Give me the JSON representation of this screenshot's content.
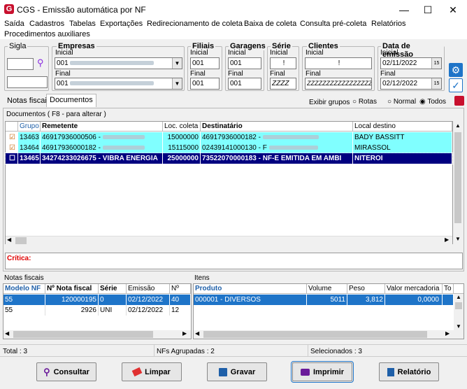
{
  "window": {
    "title": "CGS - Emissão automática por NF",
    "logo_letter": "G"
  },
  "menu": [
    "Saída",
    "Cadastros",
    "Tabelas",
    "Exportações",
    "Redirecionamento de coleta",
    "Baixa de coleta",
    "Consulta pré-coleta",
    "Relatórios",
    "Procedimentos auxiliares"
  ],
  "filters": {
    "sigla": {
      "label": "Sigla"
    },
    "empresas": {
      "label": "Empresas",
      "inicial_label": "Inicial",
      "inicial": "001",
      "final_label": "Final",
      "final": "001"
    },
    "filiais": {
      "label": "Filiais",
      "inicial_label": "Inicial",
      "inicial": "001",
      "final_label": "Final",
      "final": "001"
    },
    "garagens": {
      "label": "Garagens",
      "inicial_label": "Inicial",
      "inicial": "001",
      "final_label": "Final",
      "final": "001"
    },
    "serie": {
      "label": "Série",
      "inicial_label": "Inicial",
      "inicial": "!",
      "final_label": "Final",
      "final": "ZZZZ"
    },
    "clientes": {
      "label": "Clientes",
      "inicial_label": "Inicial",
      "inicial": "!",
      "final_label": "Final",
      "final": "ZZZZZZZZZZZZZZZZZZ"
    },
    "data": {
      "label": "Data de emissão",
      "inicial_label": "Inicial",
      "inicial": "02/11/2022",
      "final_label": "Final",
      "final": "02/12/2022"
    }
  },
  "tabs": [
    "Notas fiscais",
    "Documentos"
  ],
  "exibir": {
    "label": "Exibir grupos",
    "options": [
      "Rotas",
      "Normal",
      "Todos"
    ],
    "selected": "Todos"
  },
  "documentos": {
    "caption": "Documentos ( F8 - para alterar )",
    "columns": [
      "Grupo",
      "Remetente",
      "Loc. coleta",
      "Destinatário",
      "Local destino"
    ],
    "rows": [
      {
        "grupo": "13463",
        "remetente": "46917936000506 -",
        "loc": "15000000",
        "dest": "46917936000182 -",
        "local": "BADY BASSITT",
        "checked": true,
        "state": "cyan"
      },
      {
        "grupo": "13464",
        "remetente": "46917936000182 -",
        "loc": "15115000",
        "dest": "02439141000130 - F",
        "local": "MIRASSOL",
        "checked": true,
        "state": "cyan"
      },
      {
        "grupo": "13465",
        "remetente": "34274233026675 - VIBRA ENERGIA",
        "loc": "25000000",
        "dest": "73522070000183 - NF-E EMITIDA EM AMBI",
        "local": "NITEROI",
        "checked": false,
        "state": "selected"
      }
    ]
  },
  "critica": {
    "label": "Crítica:"
  },
  "notas": {
    "caption": "Notas fiscais",
    "columns": [
      "Modelo NF",
      "Nº Nota fiscal",
      "Série",
      "Emissão",
      "Nº"
    ],
    "rows": [
      {
        "modelo": "55",
        "numero": "120000195",
        "serie": "0",
        "emissao": "02/12/2022",
        "n": "40"
      },
      {
        "modelo": "55",
        "numero": "2926",
        "serie": "UNI",
        "emissao": "02/12/2022",
        "n": "12"
      }
    ]
  },
  "itens": {
    "caption": "Itens",
    "columns": [
      "Produto",
      "Volume",
      "Peso",
      "Valor mercadoria",
      "To"
    ],
    "rows": [
      {
        "produto": "000001 - DIVERSOS",
        "volume": "5011",
        "peso": "3,812",
        "valor": "0,0000",
        "to": ""
      }
    ]
  },
  "status": {
    "total": "Total : 3",
    "agrupadas": "NFs Agrupadas : 2",
    "selecionados": "Selecionados : 3"
  },
  "buttons": {
    "consultar": "Consultar",
    "limpar": "Limpar",
    "gravar": "Gravar",
    "imprimir": "Imprimir",
    "relatorio": "Relatório"
  },
  "colors": {
    "cyan_row": "#80ffff",
    "selected_row": "#000080",
    "blue_header": "#1e5fa8",
    "icon_blue": "#1e74c8"
  }
}
